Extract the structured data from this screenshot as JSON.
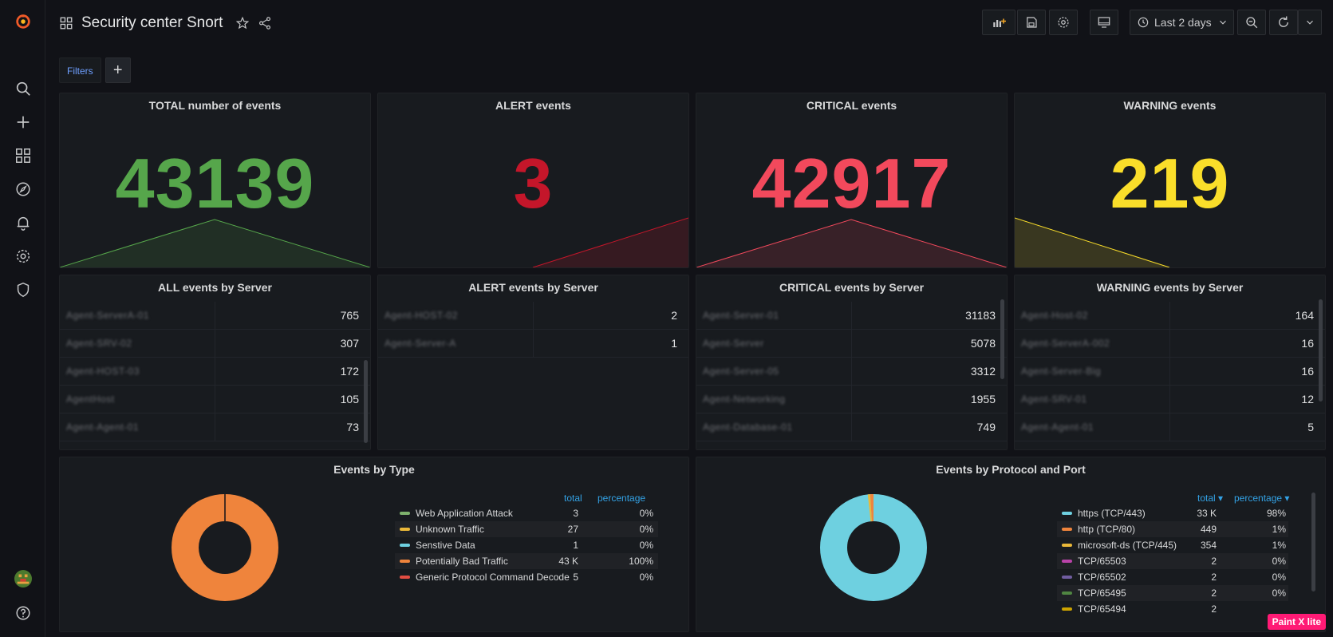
{
  "dashboard": {
    "title": "Security center Snort"
  },
  "toolbar": {
    "time_range": "Last 2 days"
  },
  "filters": {
    "label": "Filters",
    "add": "+"
  },
  "stats": [
    {
      "title": "TOTAL number of events",
      "value": "43139",
      "color": "#56a64b"
    },
    {
      "title": "ALERT events",
      "value": "3",
      "color": "#c4162a"
    },
    {
      "title": "CRITICAL events",
      "value": "42917",
      "color": "#f2495c"
    },
    {
      "title": "WARNING events",
      "value": "219",
      "color": "#fade2a"
    }
  ],
  "servers": [
    {
      "title": "ALL events by Server",
      "rows": [
        {
          "name": "Agent-ServerA-01",
          "value": "765"
        },
        {
          "name": "Agent-SRV-02",
          "value": "307"
        },
        {
          "name": "Agent-HOST-03",
          "value": "172"
        },
        {
          "name": "AgentHost",
          "value": "105"
        },
        {
          "name": "Agent-Agent-01",
          "value": "73"
        }
      ]
    },
    {
      "title": "ALERT events by Server",
      "rows": [
        {
          "name": "Agent-HOST-02",
          "value": "2"
        },
        {
          "name": "Agent-Server-A",
          "value": "1"
        }
      ]
    },
    {
      "title": "CRITICAL events by Server",
      "rows": [
        {
          "name": "Agent-Server-01",
          "value": "31183"
        },
        {
          "name": "Agent-Server",
          "value": "5078"
        },
        {
          "name": "Agent-Server-05",
          "value": "3312"
        },
        {
          "name": "Agent-Networking",
          "value": "1955"
        },
        {
          "name": "Agent-Database-01",
          "value": "749"
        }
      ]
    },
    {
      "title": "WARNING events by Server",
      "rows": [
        {
          "name": "Agent-Host-02",
          "value": "164"
        },
        {
          "name": "Agent-ServerA-002",
          "value": "16"
        },
        {
          "name": "Agent-Server-Big",
          "value": "16"
        },
        {
          "name": "Agent-SRV-01",
          "value": "12"
        },
        {
          "name": "Agent-Agent-01",
          "value": "5"
        }
      ]
    }
  ],
  "events_by_type": {
    "title": "Events by Type",
    "col_total": "total",
    "col_pct": "percentage",
    "rows": [
      {
        "name": "Web Application Attack",
        "total": "3",
        "pct": "0%",
        "color": "#7eb26d"
      },
      {
        "name": "Unknown Traffic",
        "total": "27",
        "pct": "0%",
        "color": "#eab839"
      },
      {
        "name": "Senstive Data",
        "total": "1",
        "pct": "0%",
        "color": "#6ed0e0"
      },
      {
        "name": "Potentially Bad Traffic",
        "total": "43 K",
        "pct": "100%",
        "color": "#ef843c"
      },
      {
        "name": "Generic Protocol Command Decode",
        "total": "5",
        "pct": "0%",
        "color": "#e24d42"
      }
    ]
  },
  "events_by_protocol": {
    "title": "Events by Protocol and Port",
    "col_total": "total",
    "col_pct": "percentage",
    "rows": [
      {
        "name": "https (TCP/443)",
        "total": "33 K",
        "pct": "98%",
        "color": "#6ed0e0"
      },
      {
        "name": "http (TCP/80)",
        "total": "449",
        "pct": "1%",
        "color": "#ef843c"
      },
      {
        "name": "microsoft-ds (TCP/445)",
        "total": "354",
        "pct": "1%",
        "color": "#eab839"
      },
      {
        "name": "TCP/65503",
        "total": "2",
        "pct": "0%",
        "color": "#ba43a9"
      },
      {
        "name": "TCP/65502",
        "total": "2",
        "pct": "0%",
        "color": "#705da0"
      },
      {
        "name": "TCP/65495",
        "total": "2",
        "pct": "0%",
        "color": "#508642"
      },
      {
        "name": "TCP/65494",
        "total": "2",
        "pct": "",
        "color": "#cca300"
      }
    ]
  },
  "watermark": "Paint X lite"
}
